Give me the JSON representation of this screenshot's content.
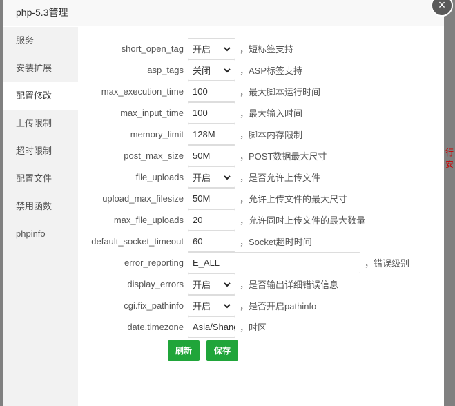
{
  "dialog": {
    "title": "php-5.3管理",
    "close_glyph": "×"
  },
  "background": {
    "right_text": "行安"
  },
  "sidebar": {
    "items": [
      {
        "label": "服务"
      },
      {
        "label": "安装扩展"
      },
      {
        "label": "配置修改"
      },
      {
        "label": "上传限制"
      },
      {
        "label": "超时限制"
      },
      {
        "label": "配置文件"
      },
      {
        "label": "禁用函数"
      },
      {
        "label": "phpinfo"
      }
    ],
    "active_index": 2
  },
  "settings": [
    {
      "label": "short_open_tag",
      "value": "开启",
      "type": "select",
      "desc": "，短标签支持"
    },
    {
      "label": "asp_tags",
      "value": "关闭",
      "type": "select",
      "desc": "，ASP标签支持"
    },
    {
      "label": "max_execution_time",
      "value": "100",
      "type": "input",
      "desc": "，最大脚本运行时间"
    },
    {
      "label": "max_input_time",
      "value": "100",
      "type": "input",
      "desc": "，最大输入时间"
    },
    {
      "label": "memory_limit",
      "value": "128M",
      "type": "input",
      "desc": "，脚本内存限制"
    },
    {
      "label": "post_max_size",
      "value": "50M",
      "type": "input",
      "desc": "，POST数据最大尺寸"
    },
    {
      "label": "file_uploads",
      "value": "开启",
      "type": "select",
      "desc": "，是否允许上传文件"
    },
    {
      "label": "upload_max_filesize",
      "value": "50M",
      "type": "input",
      "desc": "，允许上传文件的最大尺寸"
    },
    {
      "label": "max_file_uploads",
      "value": "20",
      "type": "input",
      "desc": "，允许同时上传文件的最大数量"
    },
    {
      "label": "default_socket_timeout",
      "value": "60",
      "type": "input",
      "desc": "，Socket超时时间"
    },
    {
      "label": "error_reporting",
      "value": "E_ALL",
      "type": "input-wide",
      "desc": "，错误级别"
    },
    {
      "label": "display_errors",
      "value": "开启",
      "type": "select",
      "desc": "，是否输出详细错误信息"
    },
    {
      "label": "cgi.fix_pathinfo",
      "value": "开启",
      "type": "select",
      "desc": "，是否开启pathinfo"
    },
    {
      "label": "date.timezone",
      "value": "Asia/Shanghai",
      "type": "input",
      "desc": "，时区"
    }
  ],
  "buttons": {
    "refresh": "刷新",
    "save": "保存"
  },
  "colors": {
    "accent": "#20a53a",
    "sidebar_bg": "#f2f2f2"
  }
}
